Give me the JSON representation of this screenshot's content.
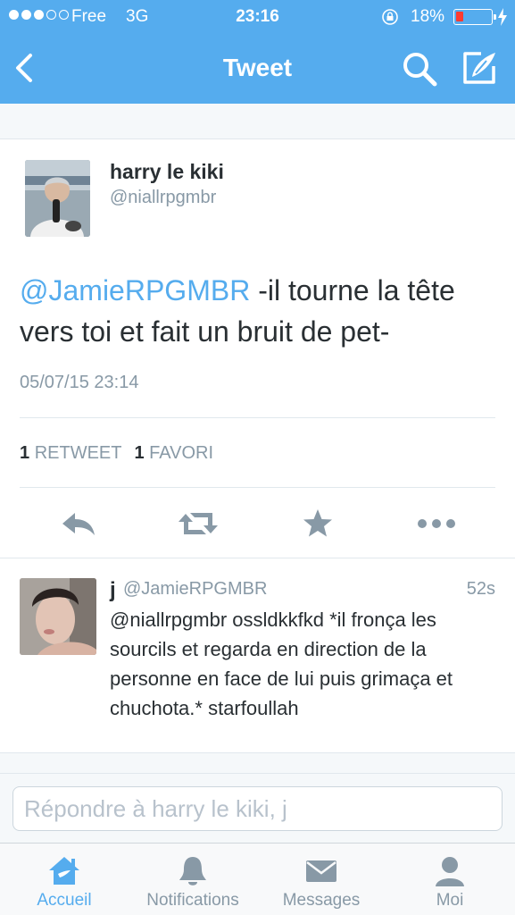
{
  "status_bar": {
    "carrier": "Free",
    "network": "3G",
    "time": "23:16",
    "battery_percent": "18%",
    "battery_level": 0.18,
    "signal_bars_filled": 3,
    "signal_bars_total": 5
  },
  "nav": {
    "title": "Tweet",
    "back_icon": "chevron-left-icon",
    "search_icon": "search-icon",
    "compose_icon": "compose-icon"
  },
  "tweet": {
    "author_name": "harry le kiki",
    "author_handle": "@niallrpgmbr",
    "mention": "@JamieRPGMBR",
    "text": " -il tourne la tête vers toi et fait un bruit de pet-",
    "timestamp": "05/07/15 23:14",
    "retweet_count": "1",
    "retweet_label": "RETWEET",
    "favorite_count": "1",
    "favorite_label": "FAVORI"
  },
  "actions": [
    {
      "name": "reply-icon"
    },
    {
      "name": "retweet-icon"
    },
    {
      "name": "favorite-star-icon"
    },
    {
      "name": "more-icon"
    }
  ],
  "reply": {
    "author_name": "j",
    "author_handle": "@JamieRPGMBR",
    "time_ago": "52s",
    "text": "@niallrpgmbr ossldkkfkd *il fronça les sourcils et regarda en direction de la personne en face de lui puis grimaça et chuchota.* starfoullah"
  },
  "composer": {
    "placeholder": "Répondre à harry le kiki, j"
  },
  "tabs": [
    {
      "label": "Accueil",
      "icon": "home-icon",
      "active": true
    },
    {
      "label": "Notifications",
      "icon": "bell-icon",
      "active": false
    },
    {
      "label": "Messages",
      "icon": "envelope-icon",
      "active": false
    },
    {
      "label": "Moi",
      "icon": "user-icon",
      "active": false
    }
  ],
  "colors": {
    "brand_blue": "#55acee",
    "text_dark": "#292f33",
    "text_gray": "#8899a6",
    "action_gray": "#8899a6",
    "battery_red": "#ff3b30"
  }
}
